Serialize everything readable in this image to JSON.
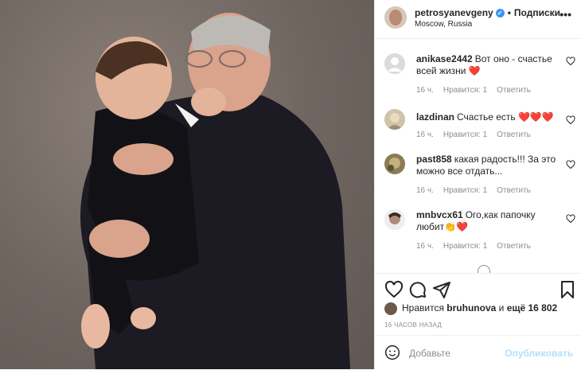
{
  "header": {
    "username": "petrosyanevgeny",
    "follow": "Подписки",
    "location": "Moscow, Russia"
  },
  "comments": [
    {
      "user": "anikase2442",
      "text": "Вот оно - счастье всей жизни ❤️",
      "time": "16 ч.",
      "likes": "Нравится: 1",
      "reply": "Ответить"
    },
    {
      "user": "lazdinan",
      "text": "Счастье есть ❤️❤️❤️",
      "time": "16 ч.",
      "likes": "Нравится: 1",
      "reply": "Ответить"
    },
    {
      "user": "past858",
      "text": "какая радость!!! За это можно все отдать...",
      "time": "16 ч.",
      "likes": "Нравится: 1",
      "reply": "Ответить"
    },
    {
      "user": "mnbvcx61",
      "text": "Ого,как папочку любит👏❤️",
      "time": "16 ч.",
      "likes": "Нравится: 1",
      "reply": "Ответить"
    }
  ],
  "likes": {
    "prefix": "Нравится",
    "user": "bruhunova",
    "middle": "и",
    "count": "ещё 16 802"
  },
  "post_time": "16 ЧАСОВ НАЗАД",
  "add_comment": {
    "placeholder": "Добавьте",
    "post_label": "Опубликовать"
  },
  "colors": {
    "accent": "#3897f0",
    "post_disabled": "#b2dffc",
    "heart": "#ed4956"
  }
}
